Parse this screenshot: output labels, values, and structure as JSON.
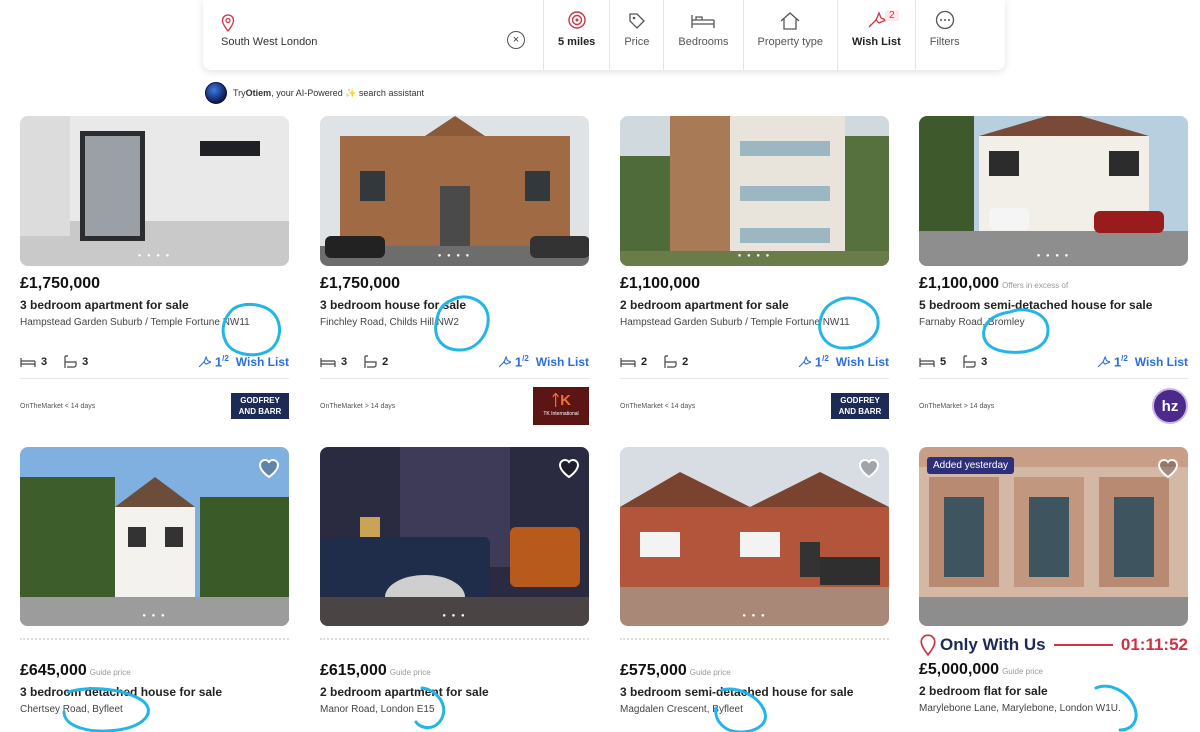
{
  "search": {
    "location": "South West London",
    "clear_icon": "close-icon",
    "filters": [
      {
        "key": "radius",
        "label": "5 miles",
        "icon": "radius-target-icon",
        "active": true
      },
      {
        "key": "price",
        "label": "Price",
        "icon": "price-tag-icon"
      },
      {
        "key": "bedrooms",
        "label": "Bedrooms",
        "icon": "bed-icon"
      },
      {
        "key": "property_type",
        "label": "Property type",
        "icon": "house-icon"
      },
      {
        "key": "wishlist",
        "label": "Wish List",
        "icon": "wishlist-icon",
        "count": "2",
        "active": true
      },
      {
        "key": "filters",
        "label": "Filters",
        "icon": "more-options-icon"
      }
    ]
  },
  "assistant": {
    "prefix": "Try ",
    "name": "Otiem",
    "suffix": ", your AI-Powered ✨ search assistant"
  },
  "listings": [
    {
      "price": "£1,750,000",
      "price_note": "",
      "type": "3 bedroom apartment for sale",
      "address": "Hampstead Garden Suburb / Temple Fortune NW11",
      "beds": "3",
      "baths": "3",
      "wish_count": "1",
      "wish_label": "Wish List",
      "source": "OnTheMarket < 14 days",
      "agent": "GODFREY AND BARR"
    },
    {
      "price": "£1,750,000",
      "price_note": "",
      "type": "3 bedroom house for sale",
      "address": "Finchley Road, Childs Hill NW2",
      "beds": "3",
      "baths": "2",
      "wish_count": "1",
      "wish_label": "Wish List",
      "source": "OnTheMarket > 14 days",
      "agent": "TK International"
    },
    {
      "price": "£1,100,000",
      "price_note": "",
      "type": "2 bedroom apartment for sale",
      "address": "Hampstead Garden Suburb / Temple Fortune NW11",
      "beds": "2",
      "baths": "2",
      "wish_count": "1",
      "wish_label": "Wish List",
      "source": "OnTheMarket < 14 days",
      "agent": "GODFREY AND BARR"
    },
    {
      "price": "£1,100,000",
      "price_note": "Offers in excess of",
      "type": "5 bedroom semi-detached house for sale",
      "address": "Farnaby Road, Bromley",
      "beds": "5",
      "baths": "3",
      "wish_count": "1",
      "wish_label": "Wish List",
      "source": "OnTheMarket > 14 days",
      "agent": "hz"
    },
    {
      "price": "£645,000",
      "price_note": "Guide price",
      "type": "3 bedroom detached house for sale",
      "address": "Chertsey Road, Byfleet",
      "badge": ""
    },
    {
      "price": "£615,000",
      "price_note": "Guide price",
      "type": "2 bedroom apartment for sale",
      "address": "Manor Road, London E15",
      "badge": ""
    },
    {
      "price": "£575,000",
      "price_note": "Guide price",
      "type": "3 bedroom semi-detached house for sale",
      "address": "Magdalen Crescent, Byfleet",
      "badge": ""
    },
    {
      "price": "£5,000,000",
      "price_note": "Guide price",
      "type": "2 bedroom flat for sale",
      "address": "Marylebone Lane, Marylebone, London W1U.",
      "badge": "Added yesterday",
      "promo": "Only With Us",
      "timer": "01:11:52"
    }
  ],
  "colors": {
    "accent": "#d03245",
    "link": "#2a6fdb",
    "navy": "#1c2a55",
    "scribble": "#22b5e6"
  }
}
